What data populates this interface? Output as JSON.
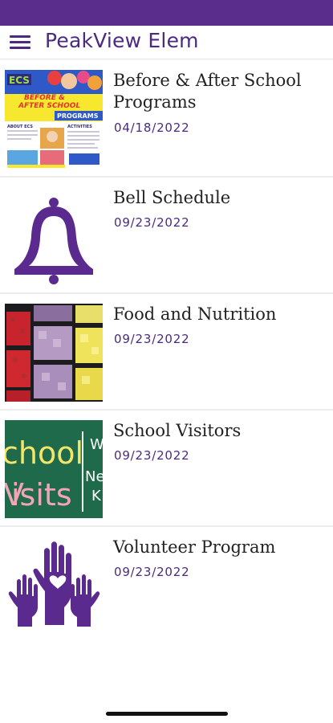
{
  "app": {
    "title": "PeakView Elem",
    "accent_color": "#4b2a80",
    "status_bar_color": "#5a2d8c"
  },
  "header": {
    "menu_icon": "hamburger-menu-icon"
  },
  "items": [
    {
      "title": "Before & After School Programs",
      "date": "04/18/2022",
      "thumbnail": {
        "type": "flyer",
        "badge": "ECS",
        "line1": "BEFORE &",
        "line2": "AFTER SCHOOL",
        "banner": "PROGRAMS",
        "left_heading": "ABOUT ECS",
        "right_heading": "ACTIVITIES"
      }
    },
    {
      "title": "Bell Schedule",
      "date": "09/23/2022",
      "thumbnail": {
        "type": "icon",
        "icon": "bell-icon"
      }
    },
    {
      "title": "Food and Nutrition",
      "date": "09/23/2022",
      "thumbnail": {
        "type": "photo",
        "subject": "fruit-trays-photo"
      }
    },
    {
      "title": "School Visitors",
      "date": "09/23/2022",
      "thumbnail": {
        "type": "chalkboard",
        "line1": "chool",
        "line2": "isits",
        "side1": "W",
        "side2": "Ne",
        "side3": "K"
      }
    },
    {
      "title": "Volunteer Program",
      "date": "09/23/2022",
      "thumbnail": {
        "type": "icon",
        "icon": "raised-hands-heart-icon"
      }
    }
  ]
}
